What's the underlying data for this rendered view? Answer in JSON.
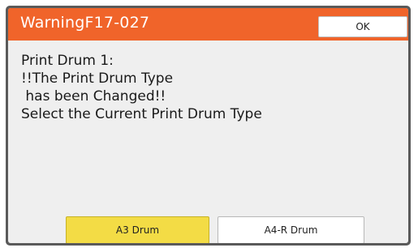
{
  "dialog": {
    "title": "WarningF17-027",
    "ok_label": "OK",
    "message_lines": [
      "Print Drum 1:",
      "!!The Print Drum Type",
      " has been Changed!!",
      "Select the Current Print Drum Type"
    ],
    "options": [
      {
        "label": "A3 Drum",
        "selected": true
      },
      {
        "label": "A4-R Drum",
        "selected": false
      }
    ]
  },
  "colors": {
    "title_bar": "#f0642a",
    "selected_button": "#f3dc45",
    "dialog_background": "#efefef",
    "frame": "#5a5a5a"
  }
}
